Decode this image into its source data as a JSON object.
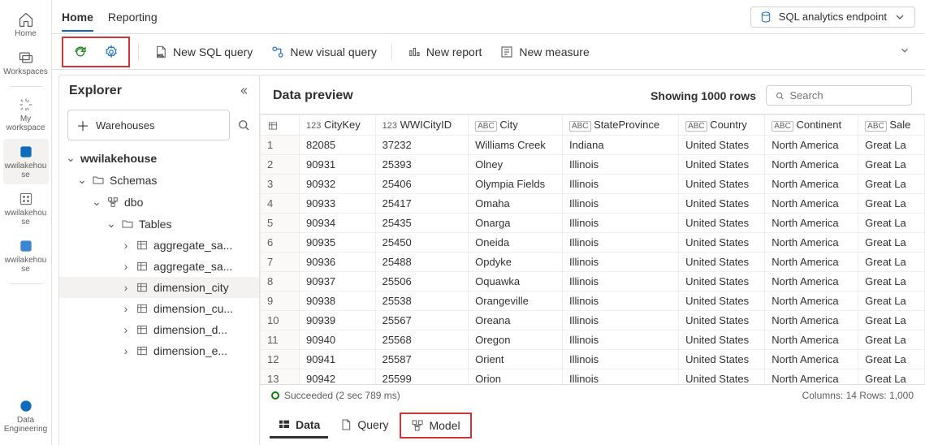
{
  "rail": {
    "home": "Home",
    "workspaces": "Workspaces",
    "myworkspace": "My\nworkspace",
    "wwilakehouse": "wwilakehou\nse",
    "wwilakehouse2": "wwilakehou\nse",
    "wwilakehouse3": "wwilakehou\nse",
    "dataeng": "Data\nEngineering"
  },
  "topbar": {
    "tabs": [
      "Home",
      "Reporting"
    ],
    "endpoint_label": "SQL analytics endpoint"
  },
  "toolbar": {
    "new_sql": "New SQL query",
    "new_visual": "New visual query",
    "new_report": "New report",
    "new_measure": "New measure"
  },
  "explorer": {
    "title": "Explorer",
    "warehouses": "Warehouses",
    "root": "wwilakehouse",
    "schemas": "Schemas",
    "dbo": "dbo",
    "tables": "Tables",
    "items": [
      "aggregate_sa...",
      "aggregate_sa...",
      "dimension_city",
      "dimension_cu...",
      "dimension_d...",
      "dimension_e..."
    ]
  },
  "preview": {
    "title": "Data preview",
    "showing": "Showing 1000 rows",
    "search_placeholder": "Search",
    "columns": [
      {
        "type": "num",
        "label": "CityKey"
      },
      {
        "type": "num",
        "label": "WWICityID"
      },
      {
        "type": "abc",
        "label": "City"
      },
      {
        "type": "abc",
        "label": "StateProvince"
      },
      {
        "type": "abc",
        "label": "Country"
      },
      {
        "type": "abc",
        "label": "Continent"
      },
      {
        "type": "abc",
        "label": "Sale"
      }
    ],
    "rows": [
      [
        "82085",
        "37232",
        "Williams Creek",
        "Indiana",
        "United States",
        "North America",
        "Great La"
      ],
      [
        "90931",
        "25393",
        "Olney",
        "Illinois",
        "United States",
        "North America",
        "Great La"
      ],
      [
        "90932",
        "25406",
        "Olympia Fields",
        "Illinois",
        "United States",
        "North America",
        "Great La"
      ],
      [
        "90933",
        "25417",
        "Omaha",
        "Illinois",
        "United States",
        "North America",
        "Great La"
      ],
      [
        "90934",
        "25435",
        "Onarga",
        "Illinois",
        "United States",
        "North America",
        "Great La"
      ],
      [
        "90935",
        "25450",
        "Oneida",
        "Illinois",
        "United States",
        "North America",
        "Great La"
      ],
      [
        "90936",
        "25488",
        "Opdyke",
        "Illinois",
        "United States",
        "North America",
        "Great La"
      ],
      [
        "90937",
        "25506",
        "Oquawka",
        "Illinois",
        "United States",
        "North America",
        "Great La"
      ],
      [
        "90938",
        "25538",
        "Orangeville",
        "Illinois",
        "United States",
        "North America",
        "Great La"
      ],
      [
        "90939",
        "25567",
        "Oreana",
        "Illinois",
        "United States",
        "North America",
        "Great La"
      ],
      [
        "90940",
        "25568",
        "Oregon",
        "Illinois",
        "United States",
        "North America",
        "Great La"
      ],
      [
        "90941",
        "25587",
        "Orient",
        "Illinois",
        "United States",
        "North America",
        "Great La"
      ],
      [
        "90942",
        "25599",
        "Orion",
        "Illinois",
        "United States",
        "North America",
        "Great La"
      ]
    ],
    "status_text": "Succeeded (2 sec 789 ms)",
    "footer_cols": "Columns: 14 Rows: 1,000"
  },
  "bottom": {
    "data": "Data",
    "query": "Query",
    "model": "Model"
  }
}
